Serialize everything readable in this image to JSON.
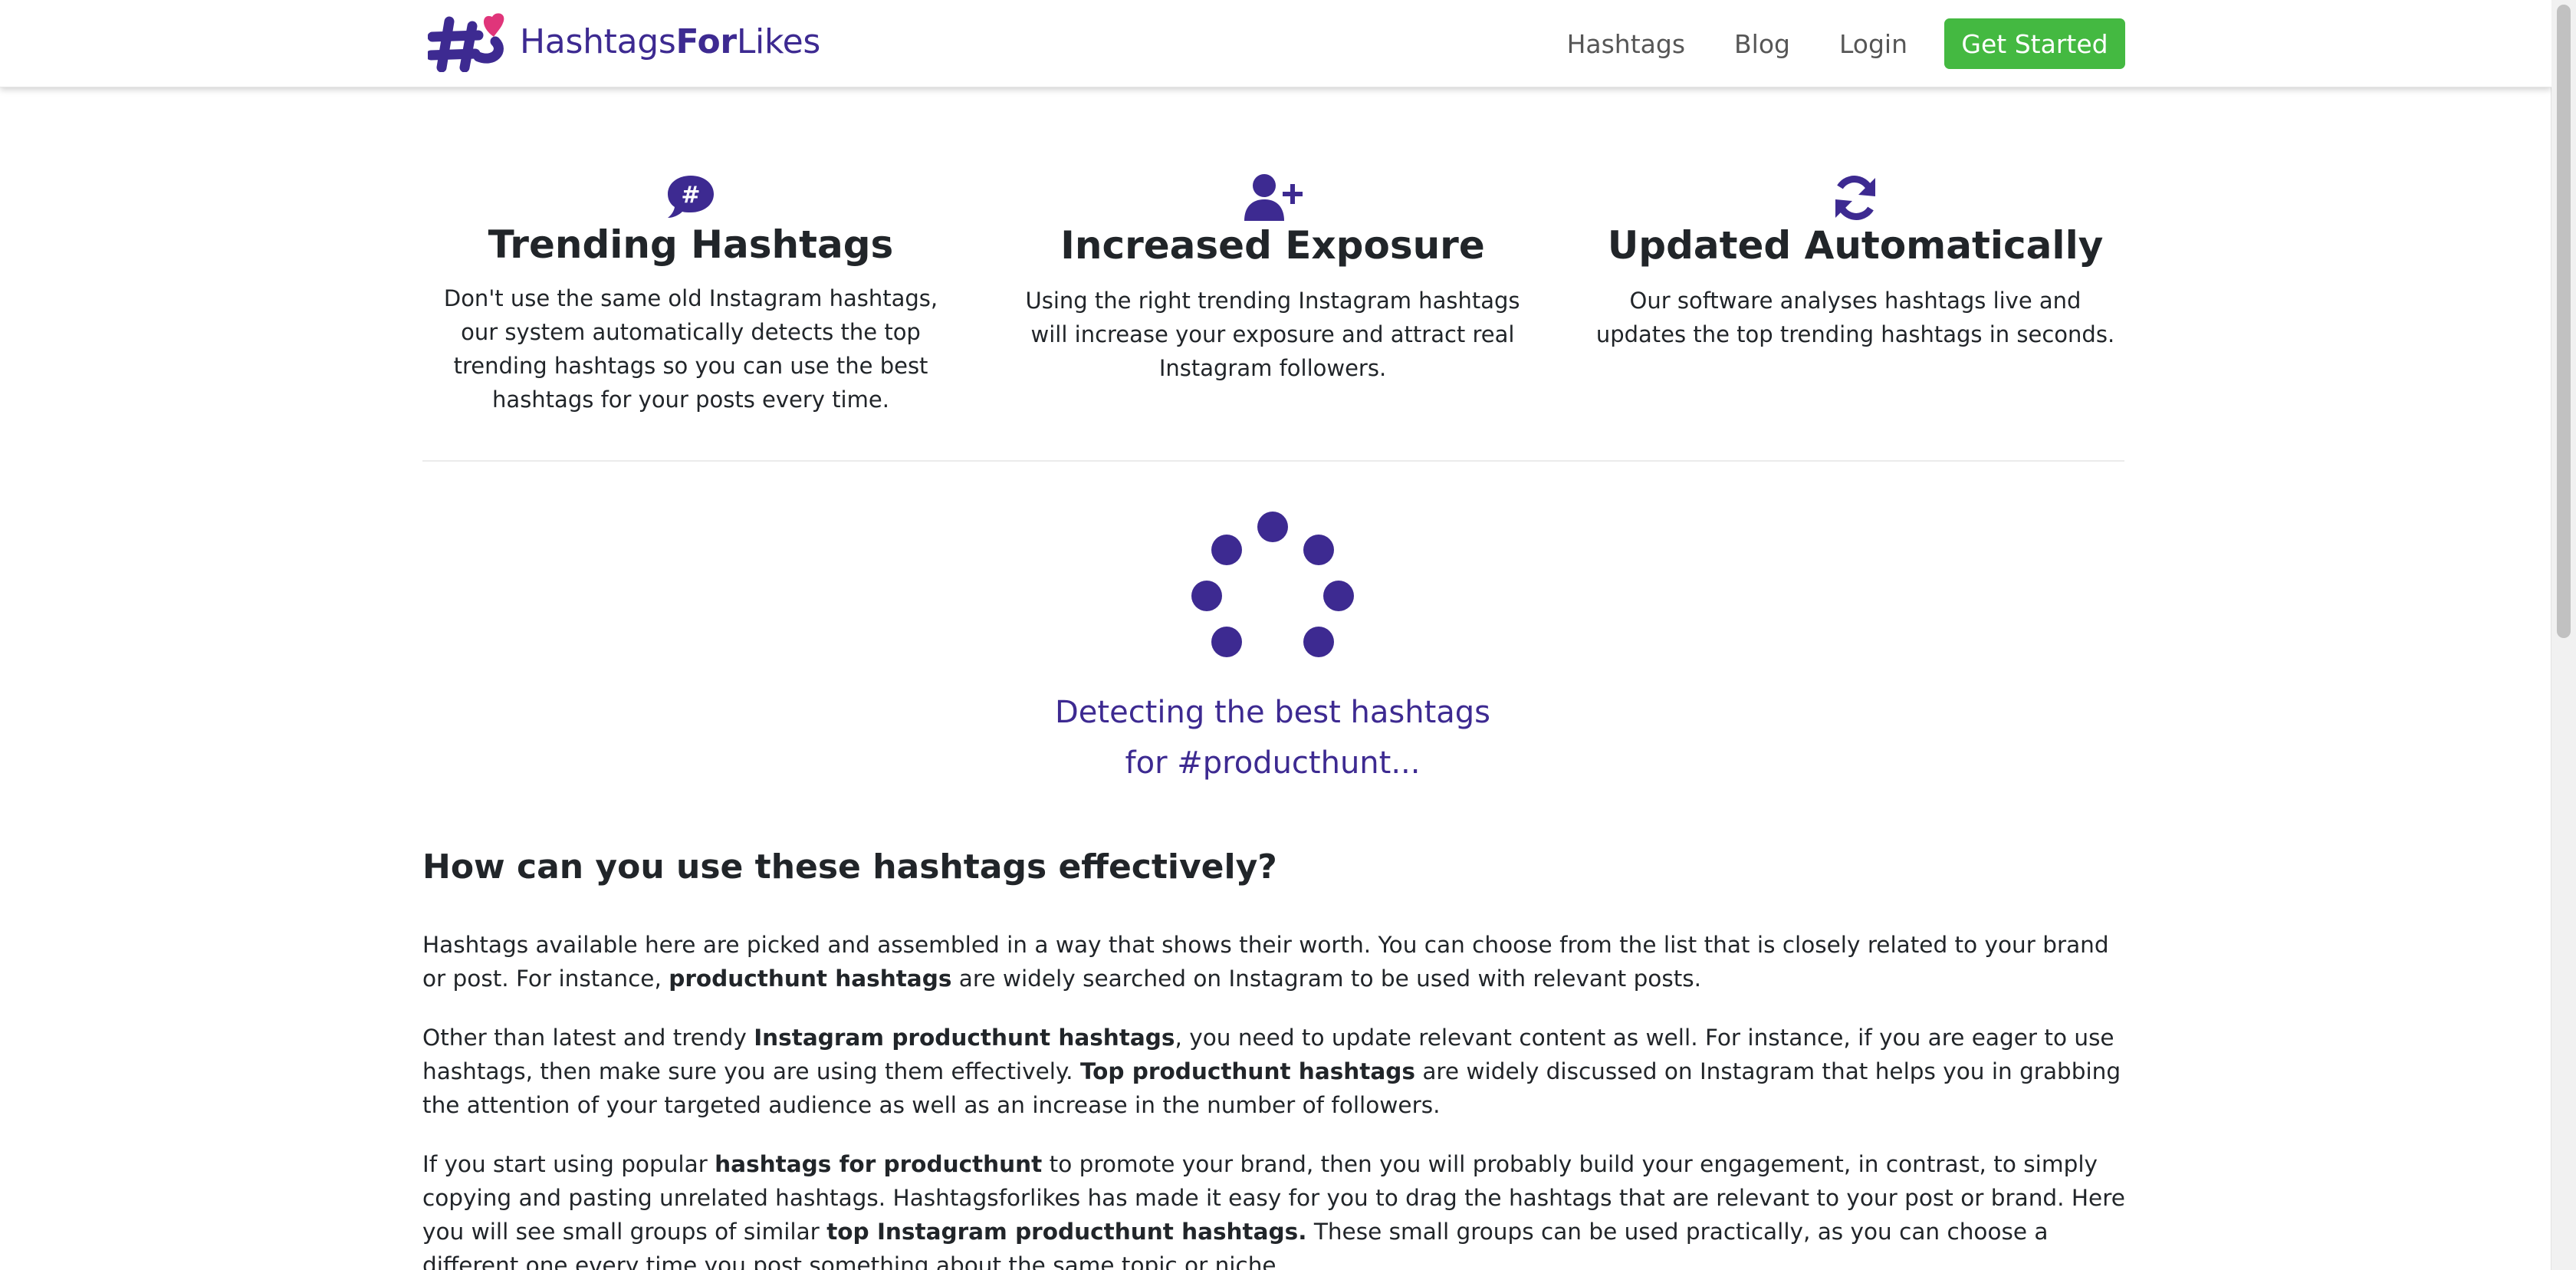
{
  "brand": {
    "name_part1": "Hashtags",
    "name_part2": "For",
    "name_part3": "Likes",
    "color": "#3d2a91",
    "heart_color": "#e0357a"
  },
  "nav": {
    "hashtags": "Hashtags",
    "blog": "Blog",
    "login": "Login",
    "cta": "Get Started",
    "cta_color": "#44b941"
  },
  "features": [
    {
      "icon": "hashtag-chat-icon",
      "title": "Trending Hashtags",
      "description": "Don't use the same old Instagram hashtags, our system automatically detects the top trending hashtags so you can use the best hashtags for your posts every time."
    },
    {
      "icon": "user-plus-icon",
      "title": "Increased Exposure",
      "description": "Using the right trending Instagram hashtags will increase your exposure and attract real Instagram followers."
    },
    {
      "icon": "refresh-icon",
      "title": "Updated Automatically",
      "description": "Our software analyses hashtags live and updates the top trending hashtags in seconds."
    }
  ],
  "loader": {
    "line1": "Detecting the best hashtags",
    "line2": "for #producthunt..."
  },
  "article": {
    "heading": "How can you use these hashtags effectively?",
    "p1": {
      "t1": "Hashtags available here are picked and assembled in a way that shows their worth. You can choose from the list that is closely related to your brand or post. For instance, ",
      "b1": "producthunt hashtags",
      "t2": " are widely searched on Instagram to be used with relevant posts."
    },
    "p2": {
      "t1": "Other than latest and trendy ",
      "b1": "Instagram producthunt hashtags",
      "t2": ", you need to update relevant content as well. For instance, if you are eager to use hashtags, then make sure you are using them effectively. ",
      "b2": "Top producthunt hashtags",
      "t3": " are widely discussed on Instagram that helps you in grabbing the attention of your targeted audience as well as an increase in the number of followers."
    },
    "p3": {
      "t1": "If you start using popular ",
      "b1": "hashtags for producthunt",
      "t2": " to promote your brand, then you will probably build your engagement, in contrast, to simply copying and pasting unrelated hashtags. Hashtagsforlikes has made it easy for you to drag the hashtags that are relevant to your post or brand. Here you will see small groups of similar ",
      "b2": "top Instagram producthunt hashtags.",
      "t3": " These small groups can be used practically, as you can choose a different one every time you post something about the same topic or niche."
    }
  }
}
